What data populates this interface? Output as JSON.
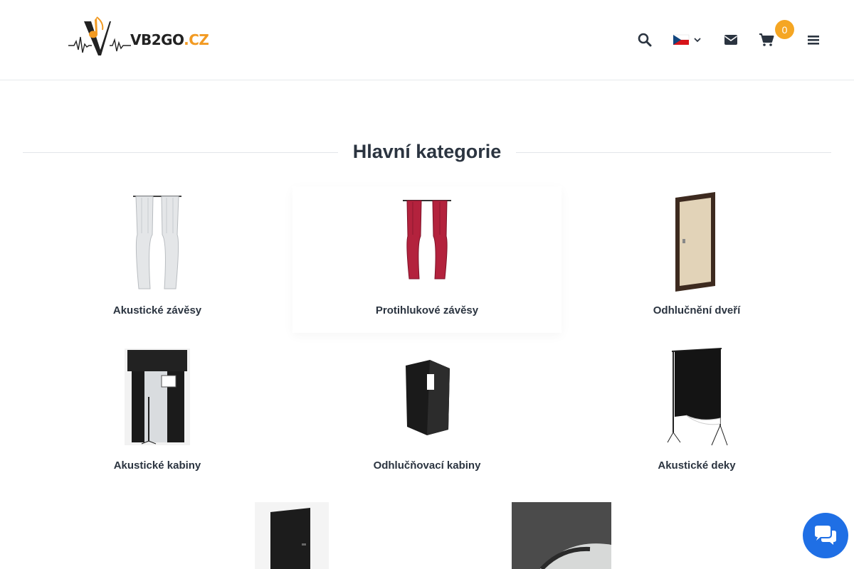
{
  "header": {
    "logo": {
      "brand": "VB2GO",
      "tld": ".CZ"
    },
    "icons": {
      "search": "search-icon",
      "language": "czech-flag-icon",
      "mail": "envelope-icon",
      "cart": "cart-icon",
      "menu": "hamburger-menu-icon"
    },
    "cart_count": "0"
  },
  "main": {
    "section_title": "Hlavní kategorie",
    "categories": [
      {
        "label": "Akustické závěsy",
        "icon": "white-curtains-image"
      },
      {
        "label": "Protihlukové závěsy",
        "icon": "red-curtains-image"
      },
      {
        "label": "Odhlučnění dveří",
        "icon": "door-image"
      },
      {
        "label": "Akustické kabiny",
        "icon": "vocal-booth-image"
      },
      {
        "label": "Odhlučňovací kabiny",
        "icon": "portable-booth-image"
      },
      {
        "label": "Akustické deky",
        "icon": "acoustic-blanket-stand-image"
      },
      {
        "label": "",
        "icon": "black-door-panel-image"
      },
      {
        "label": "",
        "icon": "acoustic-roll-image"
      }
    ]
  },
  "chat": {
    "icon": "chat-bubbles-icon"
  },
  "colors": {
    "accent": "#f5a623",
    "chat": "#1f6fe5",
    "text": "#2b3440"
  }
}
